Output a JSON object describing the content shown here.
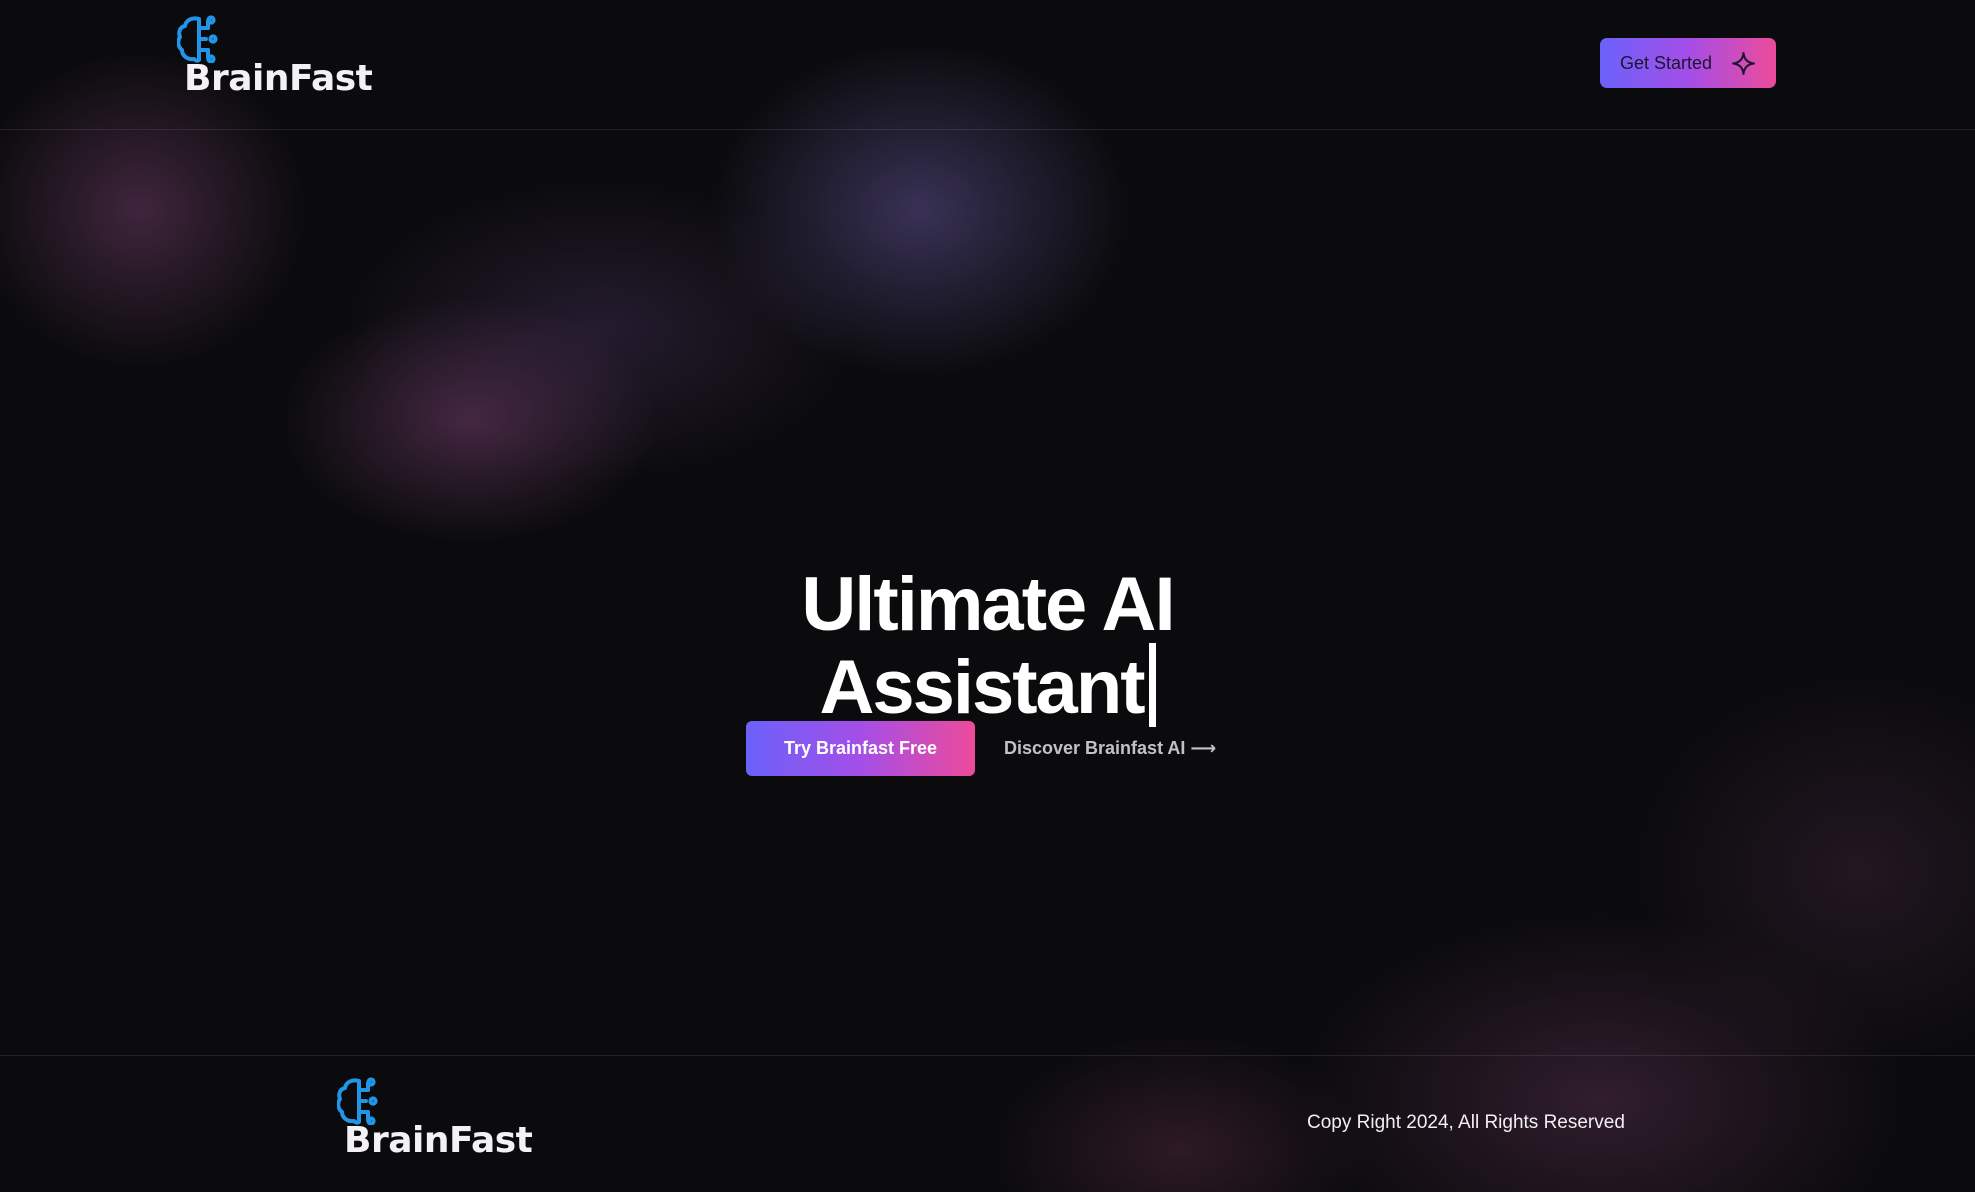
{
  "brand": {
    "name": "BrainFast",
    "icon": "brain-circuit-icon",
    "icon_color": "#2196e8"
  },
  "header": {
    "cta_label": "Get Started",
    "cta_icon": "sparkle-icon"
  },
  "hero": {
    "title_line1": "Ultimate AI",
    "title_line2": "Assistant",
    "primary_cta": "Try Brainfast Free",
    "secondary_cta": "Discover Brainfast AI ⟶"
  },
  "footer": {
    "brand_name": "BrainFast",
    "copyright": "Copy Right 2024, All Rights Reserved"
  },
  "colors": {
    "background": "#0b0b0d",
    "gradient_start": "#6b62fa",
    "gradient_mid": "#a44ee8",
    "gradient_end": "#ed4b9a",
    "muted_text": "#c2c1c9"
  }
}
